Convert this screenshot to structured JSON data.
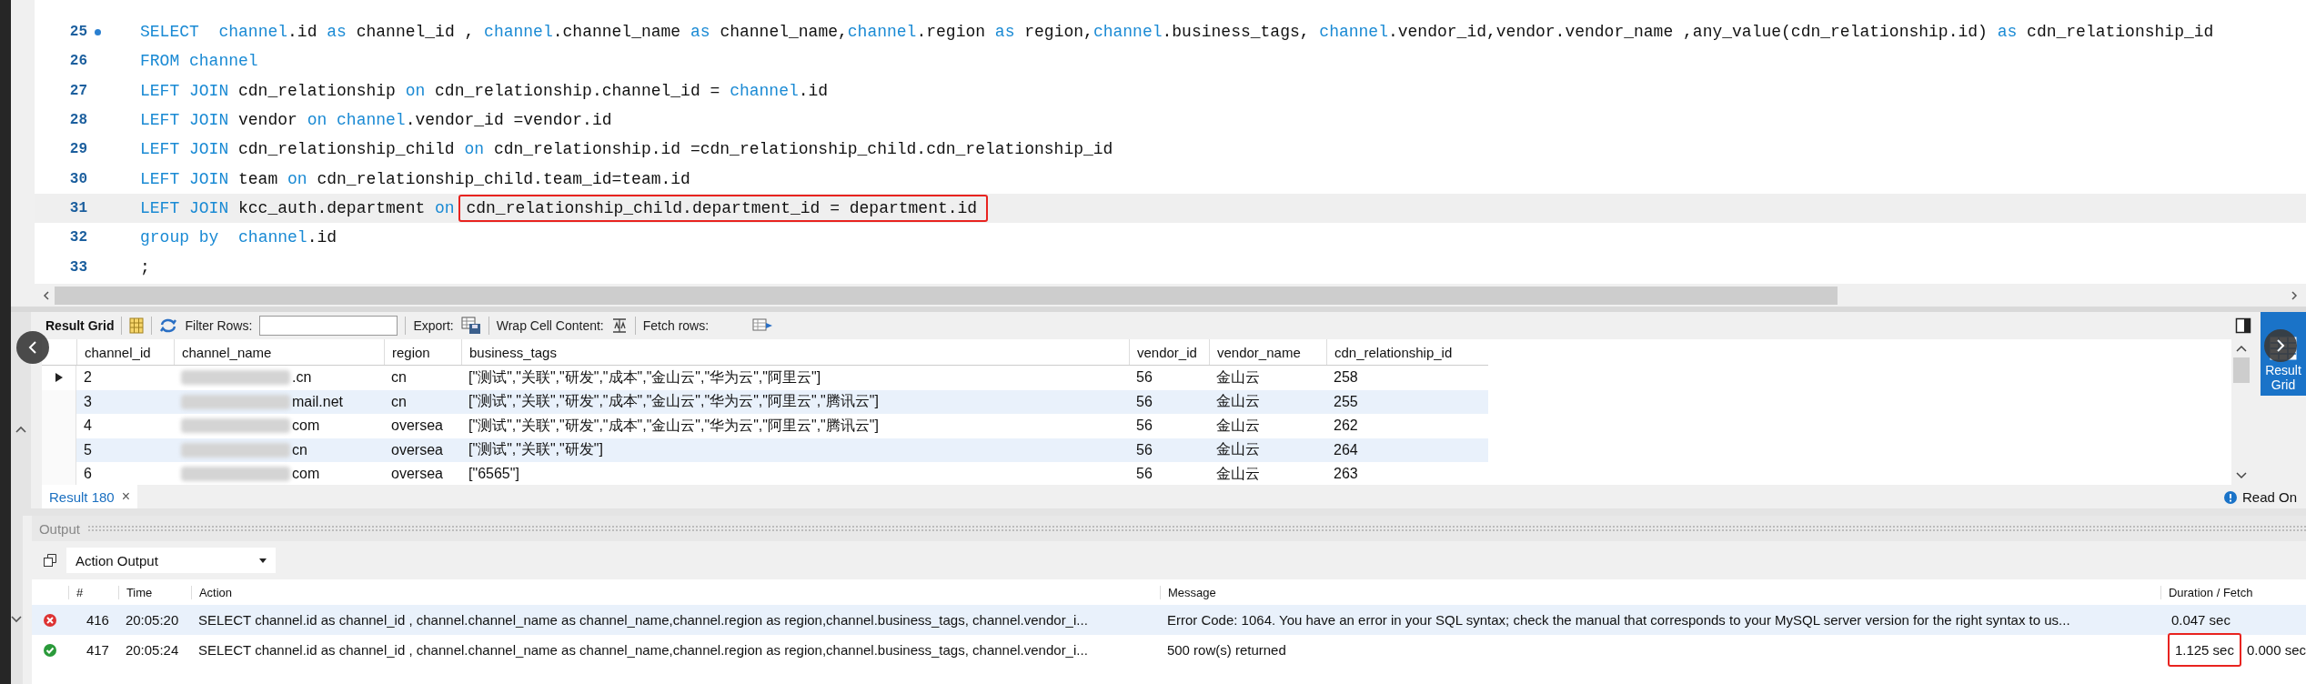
{
  "editor": {
    "lines": [
      {
        "number": "25",
        "bookmark": true,
        "current": false,
        "tokens": [
          {
            "kind": "keyword",
            "text": "SELECT  "
          },
          {
            "kind": "keyword",
            "text": "channel"
          },
          {
            "kind": "plain",
            "text": ".id "
          },
          {
            "kind": "keyword",
            "text": "as"
          },
          {
            "kind": "plain",
            "text": " channel_id , "
          },
          {
            "kind": "keyword",
            "text": "channel"
          },
          {
            "kind": "plain",
            "text": ".channel_name "
          },
          {
            "kind": "keyword",
            "text": "as"
          },
          {
            "kind": "plain",
            "text": " channel_name,"
          },
          {
            "kind": "keyword",
            "text": "channel"
          },
          {
            "kind": "plain",
            "text": ".region "
          },
          {
            "kind": "keyword",
            "text": "as"
          },
          {
            "kind": "plain",
            "text": " region,"
          },
          {
            "kind": "keyword",
            "text": "channel"
          },
          {
            "kind": "plain",
            "text": ".business_tags, "
          },
          {
            "kind": "keyword",
            "text": "channel"
          },
          {
            "kind": "plain",
            "text": ".vendor_id,vendor.vendor_name ,any_value(cdn_relationship.id) "
          },
          {
            "kind": "keyword",
            "text": "as"
          },
          {
            "kind": "plain",
            "text": " cdn_relationship_id"
          }
        ]
      },
      {
        "number": "26",
        "bookmark": false,
        "current": false,
        "tokens": [
          {
            "kind": "keyword",
            "text": "FROM channel"
          }
        ]
      },
      {
        "number": "27",
        "bookmark": false,
        "current": false,
        "tokens": [
          {
            "kind": "keyword",
            "text": "LEFT JOIN"
          },
          {
            "kind": "plain",
            "text": " cdn_relationship "
          },
          {
            "kind": "keyword",
            "text": "on"
          },
          {
            "kind": "plain",
            "text": " cdn_relationship.channel_id = "
          },
          {
            "kind": "keyword",
            "text": "channel"
          },
          {
            "kind": "plain",
            "text": ".id"
          }
        ]
      },
      {
        "number": "28",
        "bookmark": false,
        "current": false,
        "tokens": [
          {
            "kind": "keyword",
            "text": "LEFT JOIN"
          },
          {
            "kind": "plain",
            "text": " vendor "
          },
          {
            "kind": "keyword",
            "text": "on "
          },
          {
            "kind": "keyword",
            "text": "channel"
          },
          {
            "kind": "plain",
            "text": ".vendor_id =vendor.id"
          }
        ]
      },
      {
        "number": "29",
        "bookmark": false,
        "current": false,
        "tokens": [
          {
            "kind": "keyword",
            "text": "LEFT JOIN"
          },
          {
            "kind": "plain",
            "text": " cdn_relationship_child "
          },
          {
            "kind": "keyword",
            "text": "on"
          },
          {
            "kind": "plain",
            "text": " cdn_relationship.id =cdn_relationship_child.cdn_relationship_id"
          }
        ]
      },
      {
        "number": "30",
        "bookmark": false,
        "current": false,
        "tokens": [
          {
            "kind": "keyword",
            "text": "LEFT JOIN"
          },
          {
            "kind": "plain",
            "text": " team "
          },
          {
            "kind": "keyword",
            "text": "on"
          },
          {
            "kind": "plain",
            "text": " cdn_relationship_child.team_id=team.id"
          }
        ]
      },
      {
        "number": "31",
        "bookmark": false,
        "current": true,
        "tokens": [
          {
            "kind": "keyword",
            "text": "LEFT JOIN"
          },
          {
            "kind": "plain",
            "text": " kcc_auth.department "
          },
          {
            "kind": "keyword",
            "text": "on "
          },
          {
            "kind": "boxed",
            "text": "cdn_relationship_child.department_id = department.id"
          }
        ]
      },
      {
        "number": "32",
        "bookmark": false,
        "current": false,
        "tokens": [
          {
            "kind": "keyword",
            "text": "group by  "
          },
          {
            "kind": "keyword",
            "text": "channel"
          },
          {
            "kind": "plain",
            "text": ".id"
          }
        ]
      },
      {
        "number": "33",
        "bookmark": false,
        "current": false,
        "tokens": [
          {
            "kind": "plain",
            "text": ";"
          }
        ]
      }
    ]
  },
  "result_toolbar": {
    "title": "Result Grid",
    "filter_label": "Filter Rows:",
    "export_label": "Export:",
    "wrap_label": "Wrap Cell Content:",
    "fetch_label": "Fetch rows:"
  },
  "grid": {
    "columns": [
      "channel_id",
      "channel_name",
      "region",
      "business_tags",
      "vendor_id",
      "vendor_name",
      "cdn_relationship_id"
    ],
    "rows": [
      {
        "selected": true,
        "redacted": true,
        "cells": [
          "2",
          ".cn",
          "cn",
          "[\"测试\",\"关联\",\"研发\",\"成本\",\"金山云\",\"华为云\",\"阿里云\"]",
          "56",
          "金山云",
          "258"
        ]
      },
      {
        "selected": false,
        "redacted": true,
        "cells": [
          "3",
          "mail.net",
          "cn",
          "[\"测试\",\"关联\",\"研发\",\"成本\",\"金山云\",\"华为云\",\"阿里云\",\"腾讯云\"]",
          "56",
          "金山云",
          "255"
        ]
      },
      {
        "selected": false,
        "redacted": true,
        "cells": [
          "4",
          "com",
          "oversea",
          "[\"测试\",\"关联\",\"研发\",\"成本\",\"金山云\",\"华为云\",\"阿里云\",\"腾讯云\"]",
          "56",
          "金山云",
          "262"
        ]
      },
      {
        "selected": false,
        "redacted": true,
        "cells": [
          "5",
          "cn",
          "oversea",
          "[\"测试\",\"关联\",\"研发\"]",
          "56",
          "金山云",
          "264"
        ]
      },
      {
        "selected": false,
        "redacted": true,
        "cells": [
          "6",
          "com",
          "oversea",
          "[\"6565\"]",
          "56",
          "金山云",
          "263"
        ]
      }
    ]
  },
  "result_tabs": [
    {
      "label": "Result 180",
      "close": "×",
      "selected": true
    }
  ],
  "side_panel": {
    "label": "Result Grid",
    "status": "Read On"
  },
  "output": {
    "title": "Output",
    "dropdown": "Action Output",
    "columns": [
      "#",
      "Time",
      "Action",
      "Message",
      "Duration / Fetch"
    ],
    "rows": [
      {
        "kind": "error",
        "boxed": false,
        "number": "416",
        "time": "20:05:20",
        "action": "SELECT  channel.id as channel_id , channel.channel_name as channel_name,channel.region as region,channel.business_tags, channel.vendor_i...",
        "message": "Error Code: 1064. You have an error in your SQL syntax; check the manual that corresponds to your MySQL server version for the right syntax to us...",
        "duration": "0.047 sec"
      },
      {
        "kind": "ok",
        "boxed": true,
        "number": "417",
        "time": "20:05:24",
        "action": "SELECT  channel.id as channel_id , channel.channel_name as channel_name,channel.region as region,channel.business_tags, channel.vendor_i...",
        "message": "500 row(s) returned",
        "duration": "1.125 sec",
        "fetch": "0.000 sec"
      }
    ]
  }
}
